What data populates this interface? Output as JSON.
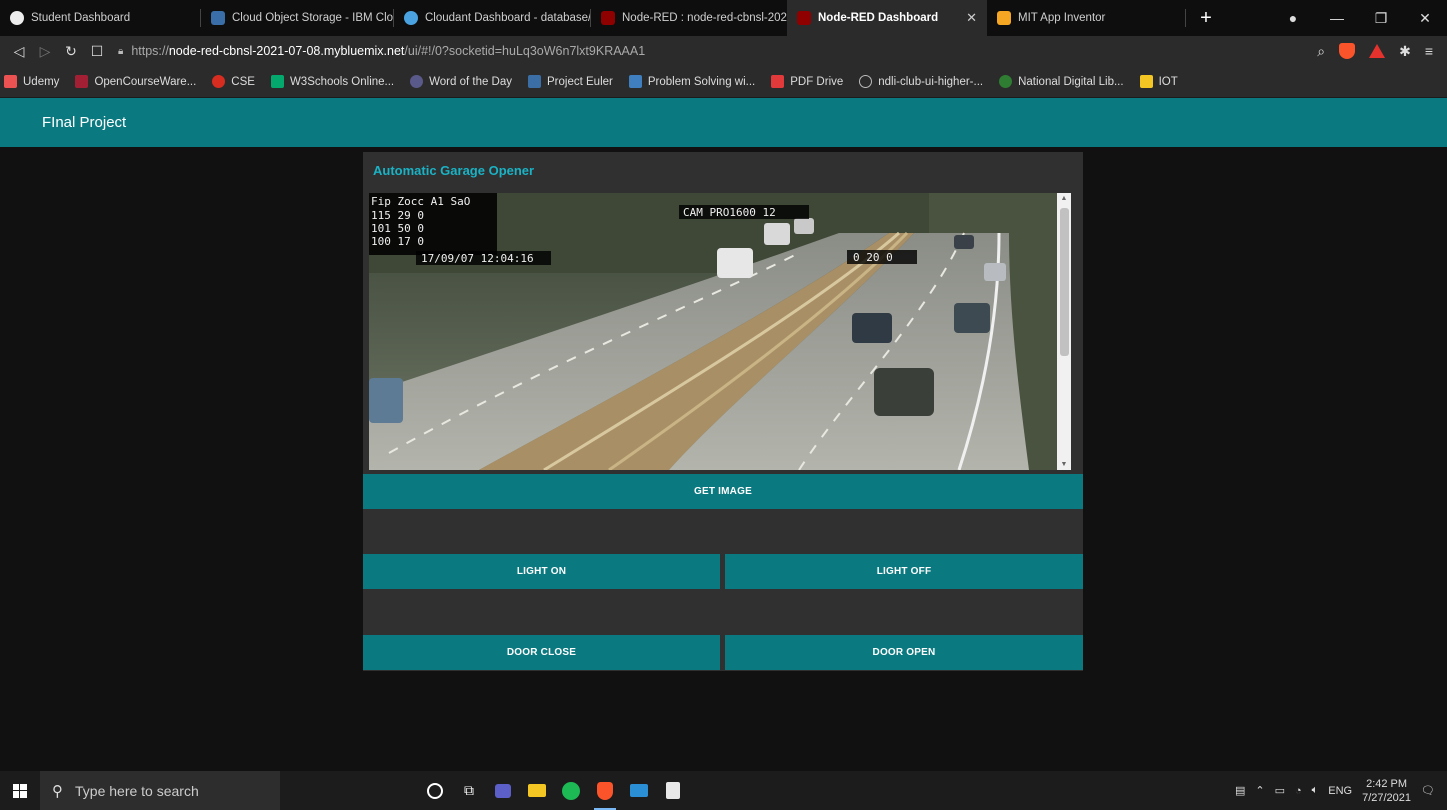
{
  "tabs": [
    {
      "label": "Student Dashboard",
      "icon": "github-icon"
    },
    {
      "label": "Cloud Object Storage - IBM Clou",
      "icon": "ibm-cloud-icon"
    },
    {
      "label": "Cloudant Dashboard - database/",
      "icon": "cloudant-icon"
    },
    {
      "label": "Node-RED : node-red-cbnsl-202",
      "icon": "node-red-icon"
    },
    {
      "label": "Node-RED Dashboard",
      "icon": "node-red-icon",
      "active": true
    },
    {
      "label": "MIT App Inventor",
      "icon": "app-inventor-icon"
    }
  ],
  "address": {
    "scheme": "https://",
    "host": "node-red-cbnsl-2021-07-08.mybluemix.net",
    "path": "/ui/#!/0?socketid=huLq3oW6n7lxt9KRAAA1"
  },
  "bookmarks": [
    {
      "label": "Udemy",
      "color": "#ec5252"
    },
    {
      "label": "OpenCourseWare...",
      "color": "#a31f34"
    },
    {
      "label": "CSE",
      "color": "#d62d20"
    },
    {
      "label": "W3Schools Online...",
      "color": "#04aa6d"
    },
    {
      "label": "Word of the Day",
      "color": "#5a5a8a"
    },
    {
      "label": "Project Euler",
      "color": "#3b6ea5"
    },
    {
      "label": "Problem Solving wi...",
      "color": "#3f7fbf"
    },
    {
      "label": "PDF Drive",
      "color": "#e23a3a"
    },
    {
      "label": "ndli-club-ui-higher-...",
      "color": "#2b2b2b"
    },
    {
      "label": "National Digital Lib...",
      "color": "#2e7d32"
    },
    {
      "label": "IOT",
      "color": "#f3c623"
    }
  ],
  "header": {
    "title": "FInal Project"
  },
  "card": {
    "title": "Automatic Garage Opener",
    "buttons": {
      "get_image": "GET IMAGE",
      "light_on": "LIGHT ON",
      "light_off": "LIGHT OFF",
      "door_close": "DOOR CLOSE",
      "door_open": "DOOR OPEN"
    },
    "camera_overlay": {
      "top_left": "Fip Zocc A1 SaO",
      "rows": [
        "115  29  0",
        "101  50  0",
        "100  17  0"
      ],
      "timestamp": "17/09/07 12:04:16",
      "top_right": "CAM  PRO1600 12",
      "mid_right": "0 20 0"
    }
  },
  "taskbar": {
    "search_placeholder": "Type here to search",
    "lang": "ENG",
    "time": "2:42 PM",
    "date": "7/27/2021"
  },
  "colors": {
    "accent": "#0b7a80",
    "card_title": "#1ab2c4",
    "background": "#111111",
    "card": "#303030"
  }
}
